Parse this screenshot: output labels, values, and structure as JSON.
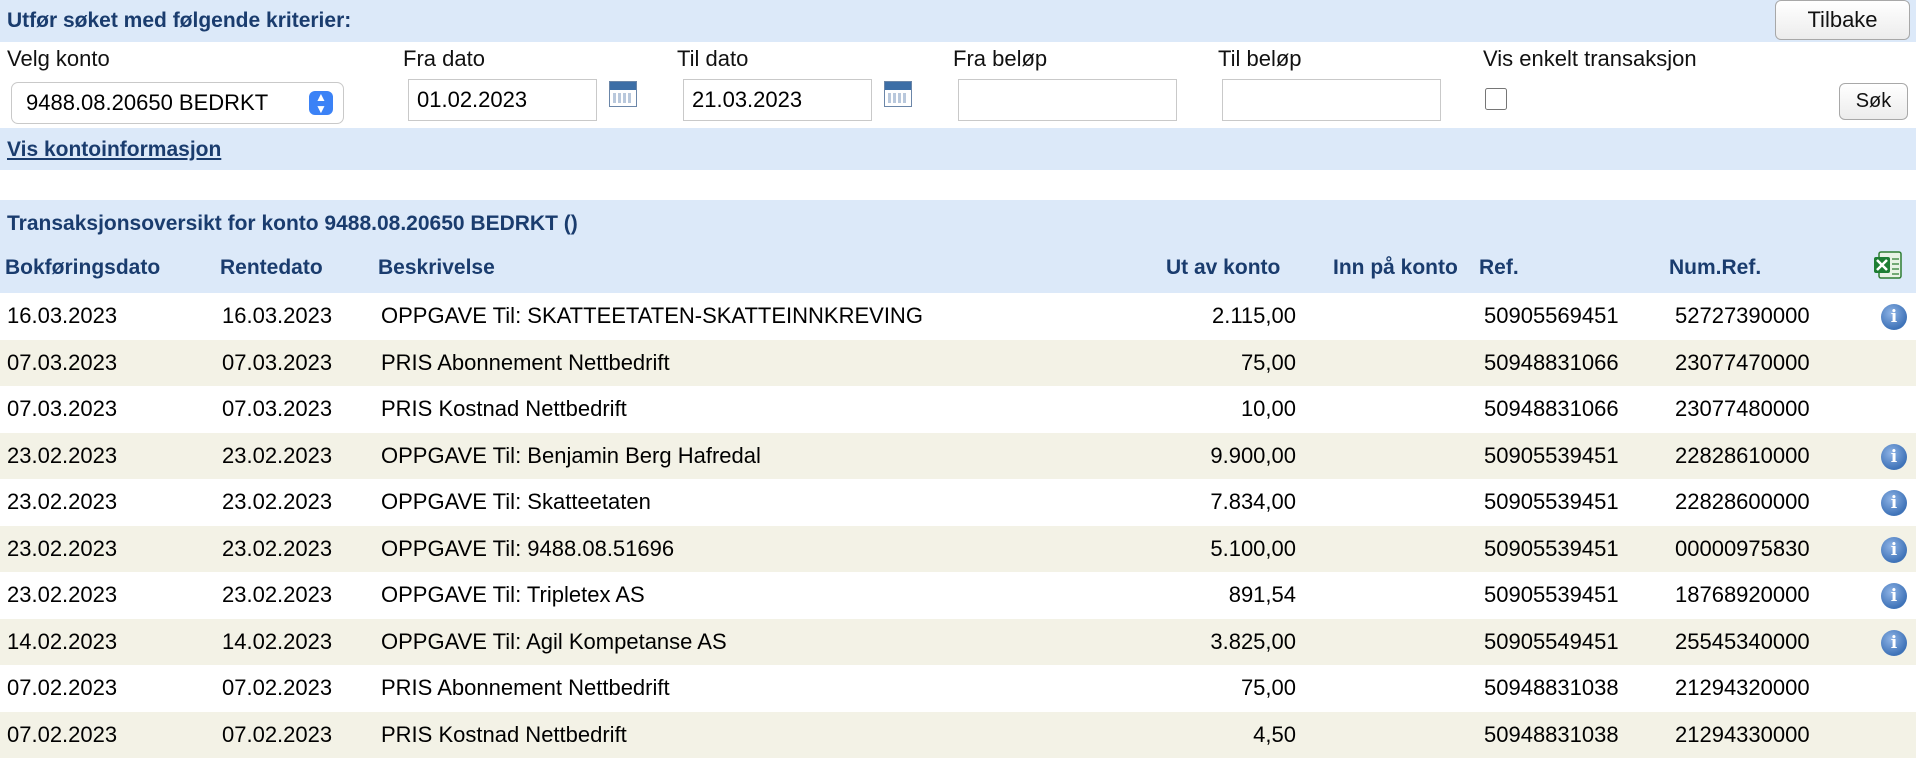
{
  "search": {
    "title": "Utfør søket med følgende kriterier:",
    "back_button": "Tilbake",
    "search_button": "Søk",
    "account_label": "Velg konto",
    "account_value": "9488.08.20650 BEDRKT",
    "from_date_label": "Fra dato",
    "from_date_value": "01.02.2023",
    "to_date_label": "Til dato",
    "to_date_value": "21.03.2023",
    "from_amount_label": "Fra beløp",
    "from_amount_value": "",
    "to_amount_label": "Til beløp",
    "to_amount_value": "",
    "single_tx_label": "Vis enkelt transaksjon",
    "single_tx_checked": false
  },
  "account_info_link": "Vis kontoinformasjon",
  "overview": {
    "title": "Transaksjonsoversikt for konto 9488.08.20650 BEDRKT ()",
    "columns": {
      "booking_date": "Bokføringsdato",
      "interest_date": "Rentedato",
      "description": "Beskrivelse",
      "out": "Ut av konto",
      "in": "Inn på konto",
      "ref": "Ref.",
      "numref": "Num.Ref."
    },
    "rows": [
      {
        "bok": "16.03.2023",
        "rente": "16.03.2023",
        "besk": "OPPGAVE Til: SKATTEETATEN-SKATTEINNKREVING",
        "ut": "2.115,00",
        "inn": "",
        "ref": "50905569451",
        "num": "52727390000",
        "info": true
      },
      {
        "bok": "07.03.2023",
        "rente": "07.03.2023",
        "besk": "PRIS Abonnement Nettbedrift",
        "ut": "75,00",
        "inn": "",
        "ref": "50948831066",
        "num": "23077470000",
        "info": false
      },
      {
        "bok": "07.03.2023",
        "rente": "07.03.2023",
        "besk": "PRIS Kostnad Nettbedrift",
        "ut": "10,00",
        "inn": "",
        "ref": "50948831066",
        "num": "23077480000",
        "info": false
      },
      {
        "bok": "23.02.2023",
        "rente": "23.02.2023",
        "besk": "OPPGAVE Til: Benjamin Berg Hafredal",
        "ut": "9.900,00",
        "inn": "",
        "ref": "50905539451",
        "num": "22828610000",
        "info": true
      },
      {
        "bok": "23.02.2023",
        "rente": "23.02.2023",
        "besk": "OPPGAVE Til: Skatteetaten",
        "ut": "7.834,00",
        "inn": "",
        "ref": "50905539451",
        "num": "22828600000",
        "info": true
      },
      {
        "bok": "23.02.2023",
        "rente": "23.02.2023",
        "besk": "OPPGAVE Til: 9488.08.51696",
        "ut": "5.100,00",
        "inn": "",
        "ref": "50905539451",
        "num": "00000975830",
        "info": true
      },
      {
        "bok": "23.02.2023",
        "rente": "23.02.2023",
        "besk": "OPPGAVE Til: Tripletex AS",
        "ut": "891,54",
        "inn": "",
        "ref": "50905539451",
        "num": "18768920000",
        "info": true
      },
      {
        "bok": "14.02.2023",
        "rente": "14.02.2023",
        "besk": "OPPGAVE Til: Agil Kompetanse AS",
        "ut": "3.825,00",
        "inn": "",
        "ref": "50905549451",
        "num": "25545340000",
        "info": true
      },
      {
        "bok": "07.02.2023",
        "rente": "07.02.2023",
        "besk": "PRIS Abonnement Nettbedrift",
        "ut": "75,00",
        "inn": "",
        "ref": "50948831038",
        "num": "21294320000",
        "info": false
      },
      {
        "bok": "07.02.2023",
        "rente": "07.02.2023",
        "besk": "PRIS Kostnad Nettbedrift",
        "ut": "4,50",
        "inn": "",
        "ref": "50948831038",
        "num": "21294330000",
        "info": false
      }
    ]
  },
  "icons": {
    "calendar": "calendar-icon",
    "info": "info-icon",
    "excel": "excel-export-icon",
    "select_chevron": "chevron-updown-icon"
  },
  "colors": {
    "header_bar": "#dce9f9",
    "heading_text": "#1a3c6e",
    "alt_row": "#f3f2e6"
  }
}
